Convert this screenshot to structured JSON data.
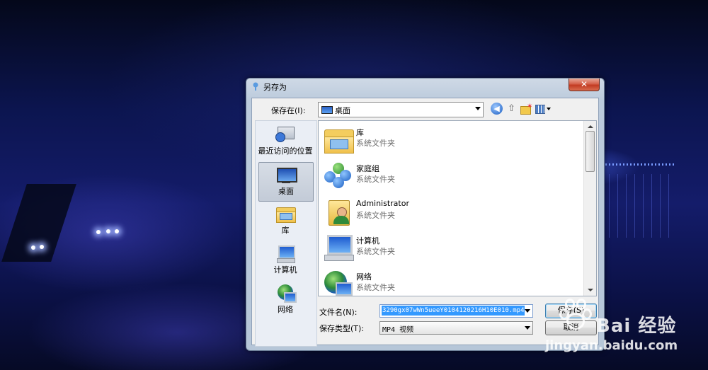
{
  "dialog": {
    "title": "另存为",
    "close_label": "✕",
    "save_in_label": "保存在(I):",
    "save_in_value": "桌面"
  },
  "places": [
    {
      "label": "最近访问的位置",
      "icon": "recent-places-icon"
    },
    {
      "label": "桌面",
      "icon": "desktop-icon",
      "selected": true
    },
    {
      "label": "库",
      "icon": "libraries-icon"
    },
    {
      "label": "计算机",
      "icon": "computer-icon"
    },
    {
      "label": "网络",
      "icon": "network-icon"
    }
  ],
  "files": [
    {
      "name": "库",
      "type": "系统文件夹",
      "icon": "libraries-folder-icon"
    },
    {
      "name": "家庭组",
      "type": "系统文件夹",
      "icon": "homegroup-icon"
    },
    {
      "name": "Administrator",
      "type": "系统文件夹",
      "icon": "user-folder-icon"
    },
    {
      "name": "计算机",
      "type": "系统文件夹",
      "icon": "computer-icon"
    },
    {
      "name": "网络",
      "type": "系统文件夹",
      "icon": "network-icon"
    }
  ],
  "form": {
    "filename_label": "文件名(N):",
    "filename_value": "3290gx07wWn5ueeY0104120216H10E010.mp4",
    "filetype_label": "保存类型(T):",
    "filetype_value": "MP4 视频",
    "save_button": "保存(S)",
    "cancel_button": "取消"
  },
  "watermark": {
    "brand": "Bai 经验",
    "url": "jingyan.baidu.com"
  },
  "colors": {
    "selection": "#3399ff",
    "close_button": "#c23b22",
    "background": "#141c6a"
  }
}
